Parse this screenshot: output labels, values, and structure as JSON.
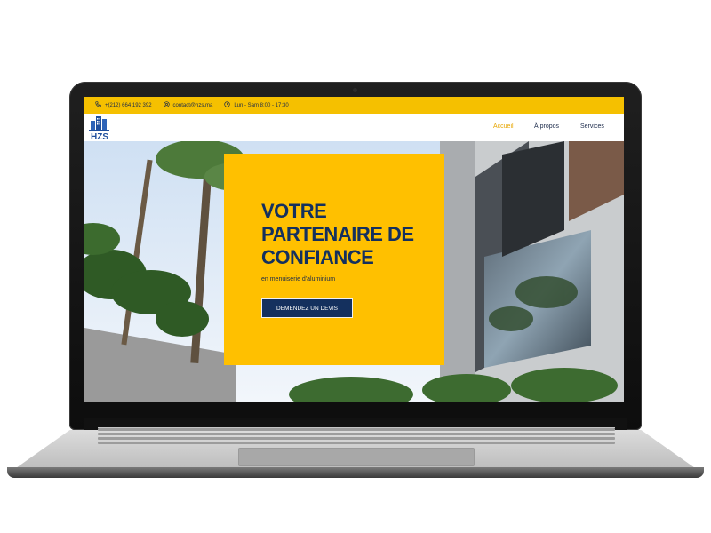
{
  "topbar": {
    "phone": "+(212) 664 192 392",
    "email": "contact@hzs.ma",
    "hours": "Lun - Sam 8:00 - 17:30"
  },
  "header": {
    "logo_text": "HZS"
  },
  "nav": {
    "items": [
      "Accueil",
      "À propos",
      "Services"
    ],
    "active_index": 0
  },
  "hero": {
    "title": "VOTRE PARTENAIRE DE CONFIANCE",
    "subtitle": "en menuiserie d'aluminium",
    "cta_label": "DEMENDEZ UN DEVIS"
  },
  "colors": {
    "accent_yellow": "#f5c000",
    "navy": "#14305e",
    "active_nav": "#e6a500"
  }
}
